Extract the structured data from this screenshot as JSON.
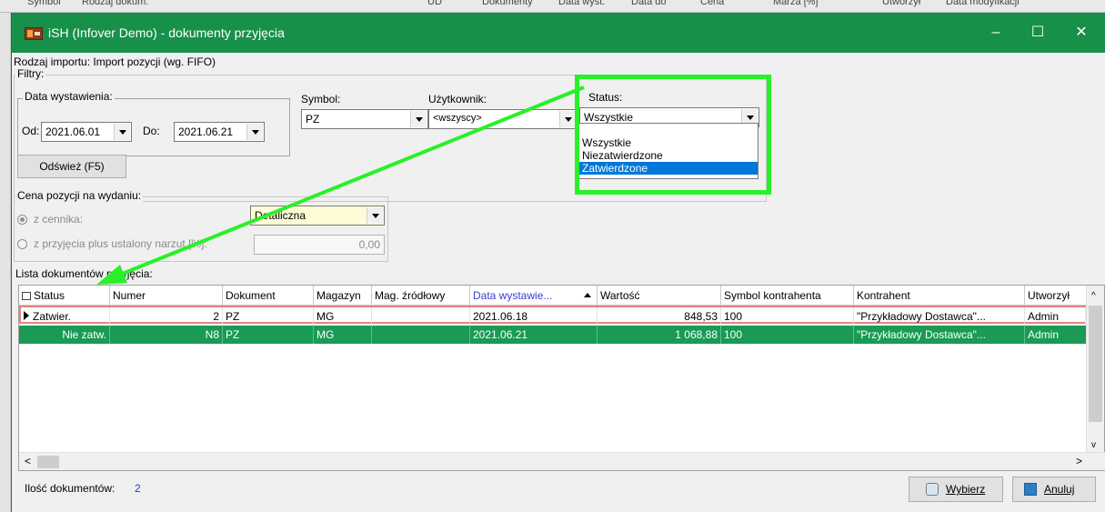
{
  "background_strip": [
    "Symbol",
    "Rodzaj dokum.",
    "UD",
    "Dokumenty",
    "Data wyst.",
    "Data do",
    "Cena",
    "Marża [%]",
    "Utworzył",
    "Data modyfikacji"
  ],
  "window": {
    "title": "iSH (Infover Demo) - dokumenty przyjęcia",
    "controls": {
      "minimize": "–",
      "maximize": "☐",
      "close": "✕"
    }
  },
  "import_type": "Rodzaj importu: Import pozycji (wg. FIFO)",
  "filters": {
    "group_label": "Filtry:",
    "date_group_label": "Data wystawienia:",
    "from_label": "Od:",
    "from_value": "2021.06.01",
    "to_label": "Do:",
    "to_value": "2021.06.21",
    "symbol_label": "Symbol:",
    "symbol_value": "PZ",
    "user_label": "Użytkownik:",
    "user_value": "<wszyscy>",
    "status_label": "Status:",
    "status_value": "Wszystkie",
    "status_options": [
      "Wszystkie",
      "Niezatwierdzone",
      "Zatwierdzone"
    ],
    "status_selected_index": 2,
    "refresh_button": "Odśwież (F5)"
  },
  "price": {
    "group_label": "Cena pozycji na wydaniu:",
    "option1": "z cennika:",
    "option1_value": "Detaliczna",
    "option2": "z przyjęcia plus ustalony narzut [%]:",
    "markup_value": "0,00"
  },
  "list": {
    "group_label": "Lista dokumentów przyjęcia:",
    "columns": [
      "Status",
      "Numer",
      "Dokument",
      "Magazyn",
      "Mag. źródłowy",
      "Data wystawie...",
      "Wartość",
      "Symbol kontrahenta",
      "Kontrahent",
      "Utworzył"
    ],
    "rows": [
      [
        "Zatwier.",
        "2",
        "PZ",
        "MG",
        "",
        "2021.06.18",
        "848,53",
        "100",
        "\"Przykładowy Dostawca\"...",
        "Admin"
      ],
      [
        "Nie zatw.",
        "N8",
        "PZ",
        "MG",
        "",
        "2021.06.21",
        "1 068,88",
        "100",
        "\"Przykładowy Dostawca\"...",
        "Admin"
      ]
    ]
  },
  "footer": {
    "count_label": "Ilość dokumentów:",
    "count_value": "2",
    "select_button": "Wybierz",
    "cancel_button": "Anuluj"
  },
  "colors": {
    "titlebar": "#17904a",
    "selected_row": "#1a9a55",
    "annotation": "#29f029",
    "dropdown_selection": "#0078d7"
  }
}
